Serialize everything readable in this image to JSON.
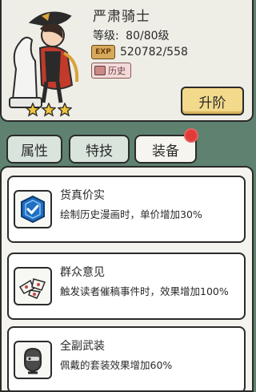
{
  "hero": {
    "name": "严肃骑士",
    "level_label": "等级:",
    "level_value": "80/80级",
    "exp_badge": "EXP",
    "exp_value": "520782/558",
    "tag_label": "历史",
    "stars": 3,
    "upgrade_label": "升阶"
  },
  "tabs": [
    {
      "label": "属性",
      "active": false
    },
    {
      "label": "特技",
      "active": false
    },
    {
      "label": "装备",
      "active": true
    }
  ],
  "cards": [
    {
      "title": "货真价实",
      "desc": "绘制历史漫画时，单价增加30%",
      "icon": "shield-check-icon"
    },
    {
      "title": "群众意见",
      "desc": "触发读者催稿事件时，效果增加100%",
      "icon": "paper-notes-icon"
    },
    {
      "title": "全副武装",
      "desc": "佩戴的套装效果增加60%",
      "icon": "armored-head-icon"
    }
  ],
  "colors": {
    "background": "#5f8270",
    "upgrade_button": "#f2d98b",
    "notification_dot": "#e23a3a",
    "shield_blue": "#1f6fc2"
  }
}
